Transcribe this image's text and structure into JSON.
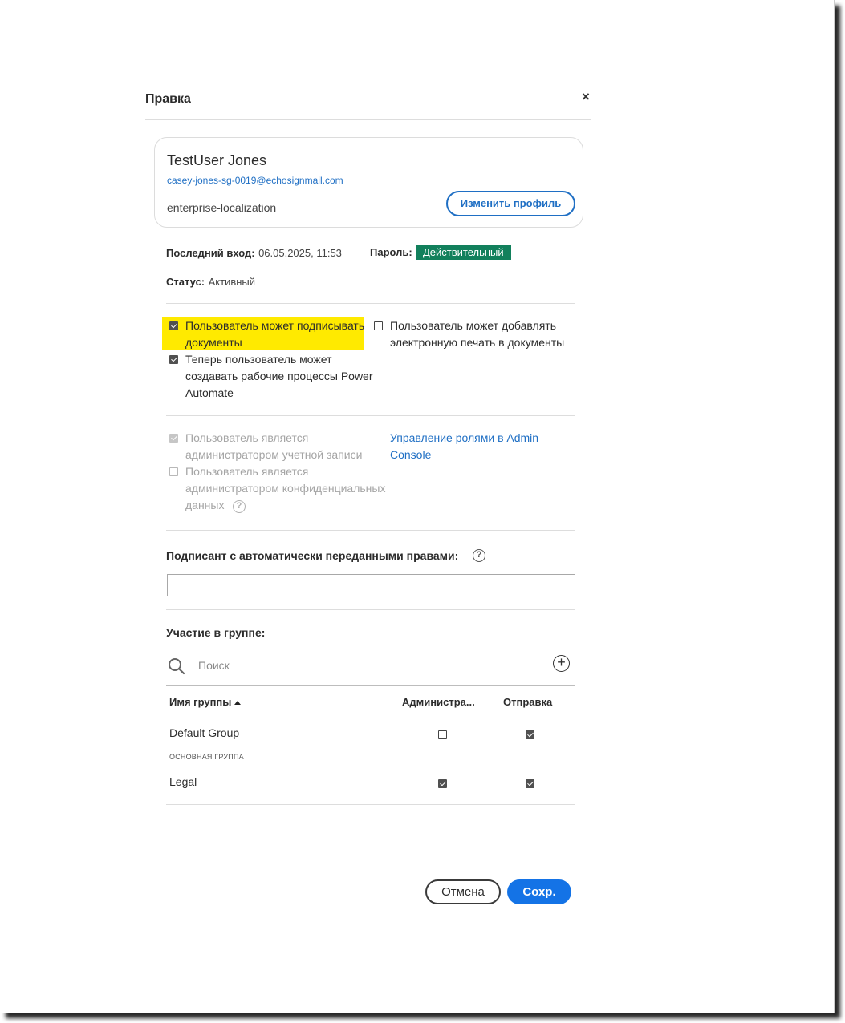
{
  "dialog": {
    "title": "Правка",
    "close_symbol": "×"
  },
  "profile": {
    "name": "TestUser Jones",
    "email": "casey-jones-sg-0019@echosignmail.com",
    "organization": "enterprise-localization",
    "edit_button": "Изменить профиль"
  },
  "meta": {
    "last_login_label": "Последний вход:",
    "last_login_value": "06.05.2025, 11:53",
    "password_label": "Пароль:",
    "password_status": "Действительный",
    "status_label": "Статус:",
    "status_value": "Активный"
  },
  "permissions": {
    "can_sign_line1": "Пользователь может подписывать",
    "can_sign_line2": "документы",
    "can_sign_checked": true,
    "power_automate_line1": "Теперь пользователь может",
    "power_automate_line2": "создавать рабочие процессы Power",
    "power_automate_line3": "Automate",
    "power_automate_checked": true,
    "eseal_line1": "Пользователь может добавлять",
    "eseal_line2": "электронную печать в документы",
    "eseal_checked": false
  },
  "admin_roles": {
    "account_admin_line1": "Пользователь является",
    "account_admin_line2": "администратором учетной записи",
    "account_admin_checked": true,
    "privacy_admin_line1": "Пользователь является",
    "privacy_admin_line2": "администратором конфиденциальных",
    "privacy_admin_line3": "данных",
    "privacy_admin_checked": false,
    "manage_link_line1": "Управление ролями в Admin",
    "manage_link_line2": "Console"
  },
  "auto_delegate": {
    "label": "Подписант с автоматически переданными правами:",
    "value": ""
  },
  "groups": {
    "section_label": "Участие в группе:",
    "search_placeholder": "Поиск",
    "columns": {
      "name": "Имя группы",
      "admin": "Администра...",
      "send": "Отправка"
    },
    "rows": [
      {
        "name": "Default Group",
        "sub": "ОСНОВНАЯ ГРУППА",
        "admin": false,
        "send": true
      },
      {
        "name": "Legal",
        "sub": "",
        "admin": true,
        "send": true
      }
    ]
  },
  "footer": {
    "cancel": "Отмена",
    "save": "Сохр."
  },
  "colors": {
    "accent": "#1473e6",
    "link": "#1f6fc4",
    "badge_green": "#12805c",
    "highlight": "#ffea00"
  }
}
